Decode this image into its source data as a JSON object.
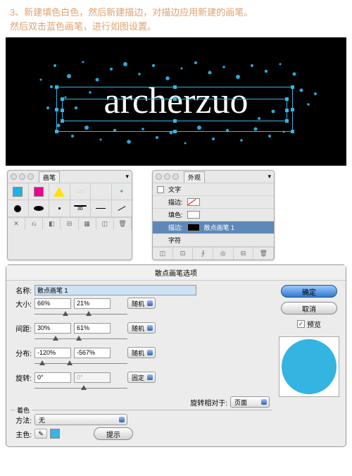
{
  "step": {
    "num": "3",
    "text1": "、新建填色白色，然后新建描边，对描边应用新建的画笔。",
    "text2": "然后双击蓝色画笔，进行如图设置。"
  },
  "canvas": {
    "text": "archerzuo"
  },
  "brushPanel": {
    "tab": "画笔",
    "menu": "▾",
    "lastCell": "30"
  },
  "appearPanel": {
    "tab": "外观",
    "rows": {
      "type": "文字",
      "stroke": "描边:",
      "fill": "填色:",
      "strokeSel": "描边:",
      "brushName": "散点画笔 1",
      "char": "字符"
    }
  },
  "dialog": {
    "title": "散点画笔选项",
    "name": {
      "label": "名称:",
      "value": "散点画笔 1"
    },
    "size": {
      "label": "大小:",
      "v1": "66%",
      "v2": "21%",
      "mode": "随机"
    },
    "spacing": {
      "label": "间距:",
      "v1": "30%",
      "v2": "61%",
      "mode": "随机"
    },
    "scatter": {
      "label": "分布:",
      "v1": "-120%",
      "v2": "-567%",
      "mode": "随机"
    },
    "rotate": {
      "label": "旋转:",
      "v1": "0°",
      "v2": "0°",
      "mode": "固定"
    },
    "relative": {
      "label": "旋转相对于:",
      "value": "页面"
    },
    "color": {
      "group": "着色",
      "method": "方法:",
      "methodVal": "无",
      "key": "主色:",
      "hint": "提示"
    },
    "buttons": {
      "ok": "确定",
      "cancel": "取消",
      "preview": "预览",
      "check": "✓"
    }
  }
}
